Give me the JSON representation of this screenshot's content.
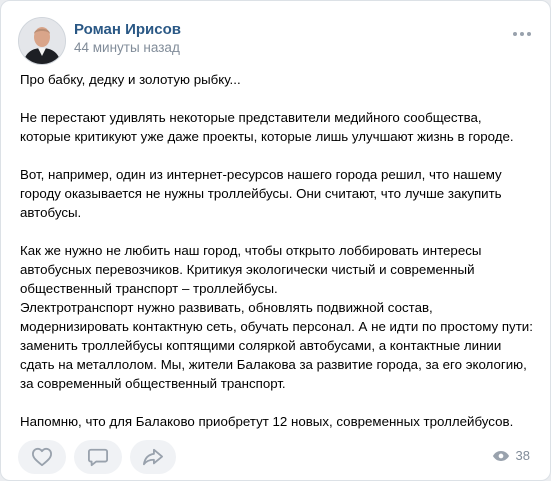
{
  "post": {
    "author": "Роман Ирисов",
    "time": "44 минуты назад",
    "paragraphs": [
      [
        "Про бабку, дедку и золотую рыбку..."
      ],
      [
        "Не перестают удивлять некоторые представители медийного сообщества,",
        "которые критикуют уже даже проекты, которые лишь улучшают жизнь в городе."
      ],
      [
        "Вот, например, один из интернет-ресурсов нашего города решил, что нашему",
        "городу оказывается не нужны троллейбусы. Они считают, что лучше закупить",
        "автобусы."
      ],
      [
        "Как же нужно не любить наш город, чтобы открыто лоббировать интересы",
        "автобусных перевозчиков. Критикуя экологически чистый и современный",
        "общественный транспорт – троллейбусы.",
        "Электротранспорт нужно развивать, обновлять подвижной состав,",
        "модернизировать контактную сеть, обучать персонал. А не идти по простому пути:",
        "заменить троллейбусы коптящими соляркой автобусами, а контактные линии",
        "сдать на металлолом. Мы, жители Балакова за развитие города, за его экологию,",
        "за современный общественный транспорт."
      ],
      [
        "Напомню, что для Балаково приобретут 12 новых, современных троллейбусов."
      ]
    ]
  },
  "stats": {
    "views": "38"
  },
  "icons": {
    "like": "heart-icon",
    "comment": "comment-icon",
    "share": "share-icon",
    "views": "eye-icon",
    "more": "more-icon"
  },
  "colors": {
    "author": "#2a5885",
    "secondary": "#818c99",
    "pill_bg": "#f0f2f5",
    "icon": "#99a2ad"
  }
}
